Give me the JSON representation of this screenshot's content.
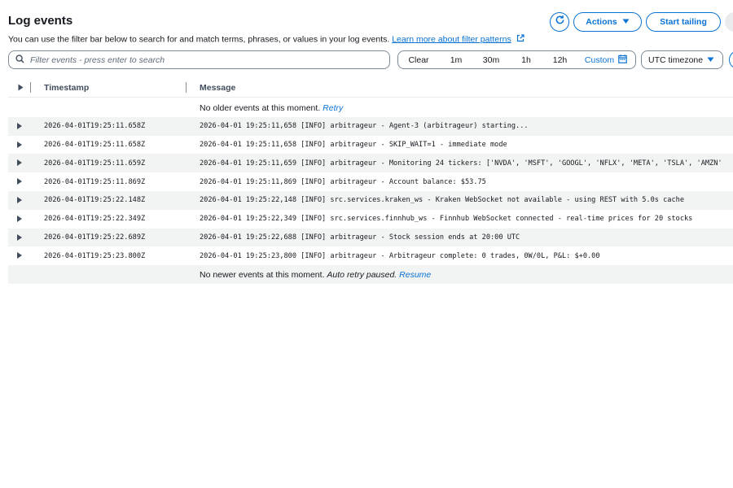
{
  "header": {
    "title": "Log events",
    "subtitle": "You can use the filter bar below to search for and match terms, phrases, or values in your log events.",
    "learn_more": "Learn more about filter patterns",
    "actions_label": "Actions",
    "start_tailing_label": "Start tailing"
  },
  "filter": {
    "placeholder": "Filter events - press enter to search",
    "time_ranges": [
      "Clear",
      "1m",
      "30m",
      "1h",
      "12h"
    ],
    "custom_label": "Custom",
    "timezone_label": "UTC timezone"
  },
  "table": {
    "columns": [
      "Timestamp",
      "Message"
    ],
    "older_text": "No older events at this moment.",
    "older_link": "Retry",
    "newer_text": "No newer events at this moment.",
    "newer_italic": "Auto retry paused.",
    "newer_link": "Resume",
    "events": [
      {
        "timestamp": "2026-04-01T19:25:11.658Z",
        "message": "2026-04-01 19:25:11,658 [INFO] arbitrageur - Agent-3 (arbitrageur) starting..."
      },
      {
        "timestamp": "2026-04-01T19:25:11.658Z",
        "message": "2026-04-01 19:25:11,658 [INFO] arbitrageur - SKIP_WAIT=1 - immediate mode"
      },
      {
        "timestamp": "2026-04-01T19:25:11.659Z",
        "message": "2026-04-01 19:25:11,659 [INFO] arbitrageur - Monitoring 24 tickers: ['NVDA', 'MSFT', 'GOOGL', 'NFLX', 'META', 'TSLA', 'AMZN'"
      },
      {
        "timestamp": "2026-04-01T19:25:11.869Z",
        "message": "2026-04-01 19:25:11,869 [INFO] arbitrageur - Account balance: $53.75"
      },
      {
        "timestamp": "2026-04-01T19:25:22.148Z",
        "message": "2026-04-01 19:25:22,148 [INFO] src.services.kraken_ws - Kraken WebSocket not available - using REST with 5.0s cache"
      },
      {
        "timestamp": "2026-04-01T19:25:22.349Z",
        "message": "2026-04-01 19:25:22,349 [INFO] src.services.finnhub_ws - Finnhub WebSocket connected - real-time prices for 20 stocks"
      },
      {
        "timestamp": "2026-04-01T19:25:22.689Z",
        "message": "2026-04-01 19:25:22,688 [INFO] arbitrageur - Stock session ends at 20:00 UTC"
      },
      {
        "timestamp": "2026-04-01T19:25:23.800Z",
        "message": "2026-04-01 19:25:23,800 [INFO] arbitrageur - Arbitrageur complete: 0 trades, 0W/0L, P&L: $+0.00"
      }
    ]
  },
  "colors": {
    "accent": "#0972d3",
    "row_shade": "#f2f3f3",
    "text": "#16191f"
  }
}
